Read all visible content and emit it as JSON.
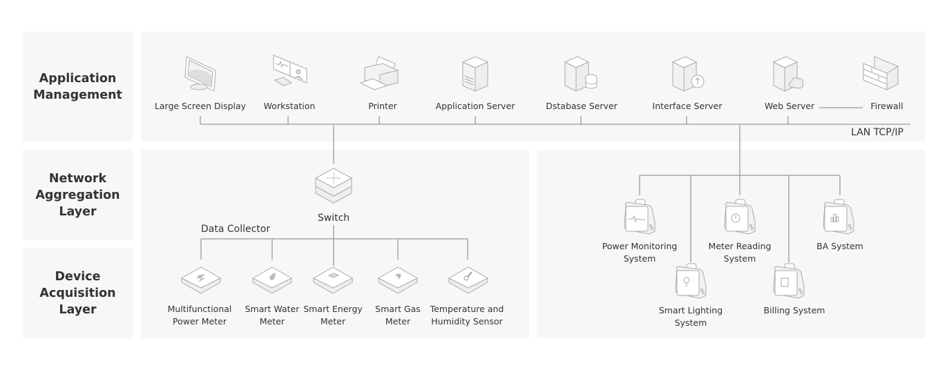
{
  "layers": [
    {
      "title_line1": "Application",
      "title_line2": "Management"
    },
    {
      "title_line1": "Network",
      "title_line2": "Aggregation",
      "title_line3": "Layer"
    },
    {
      "title_line1": "Device",
      "title_line2": "Acquisition",
      "title_line3": "Layer"
    }
  ],
  "application": {
    "items": [
      {
        "label": "Large Screen Display",
        "icon": "monitor-icon"
      },
      {
        "label": "Workstation",
        "icon": "workstation-icon"
      },
      {
        "label": "Printer",
        "icon": "printer-icon"
      },
      {
        "label": "Application Server",
        "icon": "server-icon"
      },
      {
        "label": "Dstabase Server",
        "icon": "database-server-icon"
      },
      {
        "label": "Interface Server",
        "icon": "interface-server-icon"
      },
      {
        "label": "Web Server",
        "icon": "web-server-icon"
      },
      {
        "label": "Firewall",
        "icon": "firewall-icon"
      }
    ],
    "network_label": "LAN TCP/IP"
  },
  "network": {
    "switch_label": "Switch",
    "collector_label": "Data Collector"
  },
  "devices": [
    {
      "line1": "Multifunctional",
      "line2": "Power Meter",
      "icon": "lightning-icon"
    },
    {
      "line1": "Smart Water",
      "line2": "Meter",
      "icon": "water-drop-icon"
    },
    {
      "line1": "Smart Energy",
      "line2": "Meter",
      "icon": "battery-icon"
    },
    {
      "line1": "Smart Gas",
      "line2": "Meter",
      "icon": "flame-icon"
    },
    {
      "line1": "Temperature and",
      "line2": "Humidity Sensor",
      "icon": "thermometer-icon"
    }
  ],
  "systems": [
    {
      "line1": "Power Monitoring",
      "line2": "System",
      "icon": "waveform-icon"
    },
    {
      "line1": "Smart Lighting",
      "line2": "System",
      "icon": "bulb-icon"
    },
    {
      "line1": "Meter Reading",
      "line2": "System",
      "icon": "gauge-icon"
    },
    {
      "line1": "Billing System",
      "line2": "",
      "icon": "bill-icon"
    },
    {
      "line1": "BA System",
      "line2": "",
      "icon": "bar-chart-icon"
    }
  ],
  "colors": {
    "panel": "#f7f7f7",
    "line": "#999999",
    "text": "#333333"
  }
}
